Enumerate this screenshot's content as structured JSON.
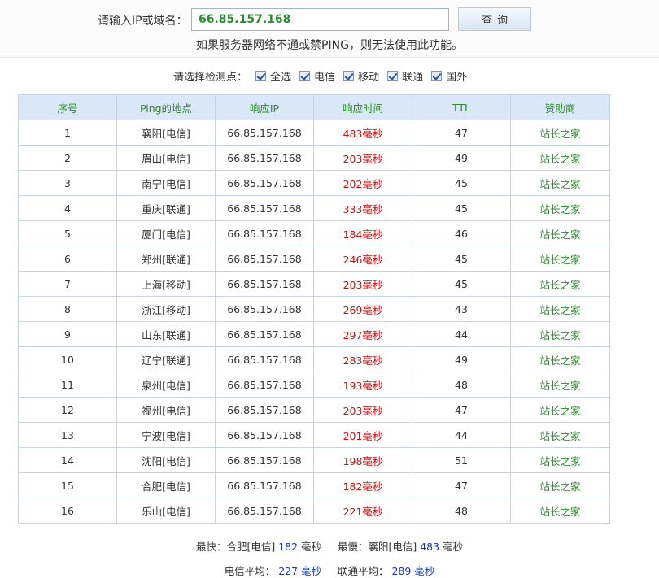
{
  "search": {
    "label": "请输入IP或域名：",
    "value": "66.85.157.168",
    "button": "查询",
    "notice": "如果服务器网络不通或禁PING，则无法使用此功能。"
  },
  "checkpoints": {
    "label": "请选择检测点：",
    "options": [
      "全选",
      "电信",
      "移动",
      "联通",
      "国外"
    ]
  },
  "table": {
    "headers": [
      "序号",
      "Ping的地点",
      "响应IP",
      "响应时间",
      "TTL",
      "赞助商"
    ],
    "rows": [
      [
        "1",
        "襄阳[电信]",
        "66.85.157.168",
        "483毫秒",
        "47",
        "站长之家"
      ],
      [
        "2",
        "眉山[电信]",
        "66.85.157.168",
        "203毫秒",
        "49",
        "站长之家"
      ],
      [
        "3",
        "南宁[电信]",
        "66.85.157.168",
        "202毫秒",
        "45",
        "站长之家"
      ],
      [
        "4",
        "重庆[联通]",
        "66.85.157.168",
        "333毫秒",
        "45",
        "站长之家"
      ],
      [
        "5",
        "厦门[电信]",
        "66.85.157.168",
        "184毫秒",
        "46",
        "站长之家"
      ],
      [
        "6",
        "郑州[联通]",
        "66.85.157.168",
        "246毫秒",
        "45",
        "站长之家"
      ],
      [
        "7",
        "上海[移动]",
        "66.85.157.168",
        "203毫秒",
        "45",
        "站长之家"
      ],
      [
        "8",
        "浙江[移动]",
        "66.85.157.168",
        "269毫秒",
        "43",
        "站长之家"
      ],
      [
        "9",
        "山东[联通]",
        "66.85.157.168",
        "297毫秒",
        "44",
        "站长之家"
      ],
      [
        "10",
        "辽宁[联通]",
        "66.85.157.168",
        "283毫秒",
        "49",
        "站长之家"
      ],
      [
        "11",
        "泉州[电信]",
        "66.85.157.168",
        "193毫秒",
        "48",
        "站长之家"
      ],
      [
        "12",
        "福州[电信]",
        "66.85.157.168",
        "203毫秒",
        "47",
        "站长之家"
      ],
      [
        "13",
        "宁波[电信]",
        "66.85.157.168",
        "201毫秒",
        "44",
        "站长之家"
      ],
      [
        "14",
        "沈阳[电信]",
        "66.85.157.168",
        "198毫秒",
        "51",
        "站长之家"
      ],
      [
        "15",
        "合肥[电信]",
        "66.85.157.168",
        "182毫秒",
        "47",
        "站长之家"
      ],
      [
        "16",
        "乐山[电信]",
        "66.85.157.168",
        "221毫秒",
        "48",
        "站长之家"
      ]
    ]
  },
  "summary": {
    "fastest_label": "最快：",
    "fastest_place": "合肥[电信]",
    "fastest_value": "182",
    "slowest_label": "最慢：",
    "slowest_place": "襄阳[电信]",
    "slowest_value": "483",
    "unit": "毫秒",
    "telecom_avg_label": "电信平均：",
    "telecom_avg_value": "227",
    "unicom_avg_label": "联通平均：",
    "unicom_avg_value": "289"
  },
  "colors": {
    "header_bg": "#d9e7f6",
    "accent_green": "#2f8a2f",
    "time_red": "#cc1111",
    "number_blue": "#1a3aa8"
  }
}
